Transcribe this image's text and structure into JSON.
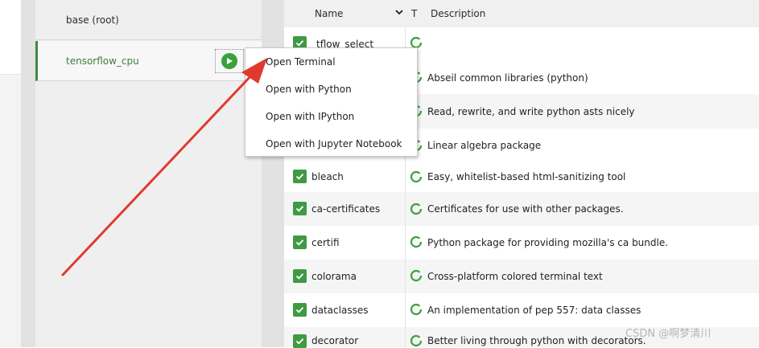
{
  "environments": [
    {
      "name": "base (root)",
      "active": false
    },
    {
      "name": "tensorflow_cpu",
      "active": true
    }
  ],
  "context_menu": {
    "items": [
      "Open Terminal",
      "Open with Python",
      "Open with IPython",
      "Open with Jupyter Notebook"
    ]
  },
  "packages_table": {
    "headers": {
      "name": "Name",
      "type": "T",
      "description": "Description"
    },
    "rows": [
      {
        "name": "_tflow_select",
        "description": ""
      },
      {
        "name": "",
        "description": "Abseil common libraries (python)"
      },
      {
        "name": "",
        "description": "Read, rewrite, and write python asts nicely"
      },
      {
        "name": "",
        "description": "Linear algebra package"
      },
      {
        "name": "bleach",
        "description": "Easy, whitelist-based html-sanitizing tool"
      },
      {
        "name": "ca-certificates",
        "description": "Certificates for use with other packages."
      },
      {
        "name": "certifi",
        "description": "Python package for providing mozilla's ca bundle."
      },
      {
        "name": "colorama",
        "description": "Cross-platform colored terminal text"
      },
      {
        "name": "dataclasses",
        "description": "An implementation of pep 557: data classes"
      },
      {
        "name": "decorator",
        "description": "Better living through python with decorators."
      }
    ]
  },
  "watermark": "CSDN @啊梦清川",
  "colors": {
    "accent_green": "#3aa23c",
    "annotation_arrow": "#e03a2f"
  },
  "icons": {
    "play": "play-icon",
    "checkbox": "checkbox-checked-icon",
    "status": "status-ring-icon",
    "sort": "chevron-down-icon"
  }
}
